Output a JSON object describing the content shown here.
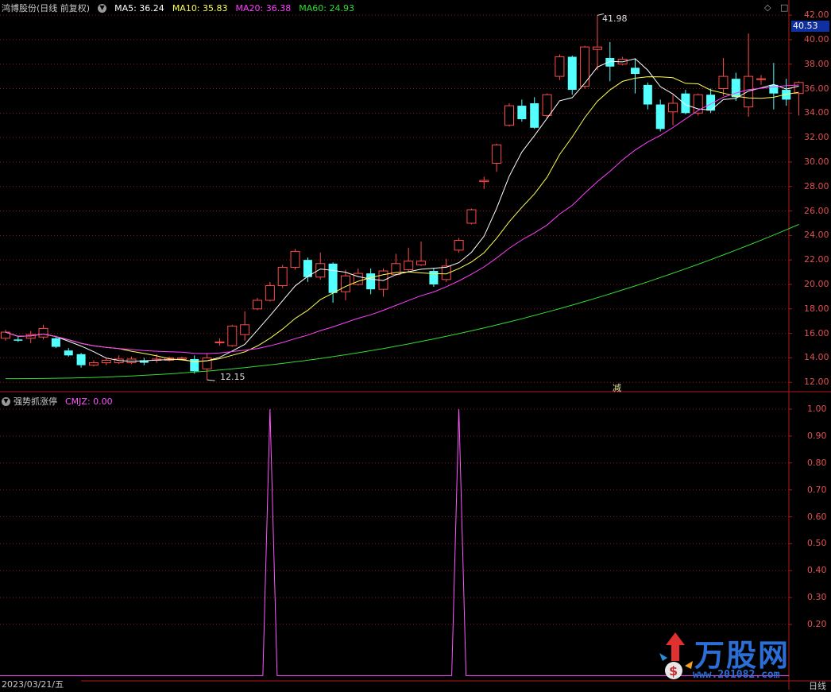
{
  "colors": {
    "background": "#000000",
    "up": "#ff4a4a",
    "down": "#54ffff",
    "grid": "#8b1a1a",
    "border": "#b01818",
    "ma5": "#ffffff",
    "ma10": "#ffff55",
    "ma20": "#ff40ff",
    "ma60": "#33dd33",
    "indicator": "#ff55ff",
    "axis_text": "#e05050",
    "price_tag_bg": "#1030a0"
  },
  "main_panel": {
    "title": "鸿博股份(日线 前复权)",
    "menu_icon": "chevron-down-icon",
    "ma": [
      {
        "label": "MA5: 36.24",
        "color": "#ffffff"
      },
      {
        "label": "MA10: 35.83",
        "color": "#ffff55"
      },
      {
        "label": "MA20: 36.38",
        "color": "#ff40ff"
      },
      {
        "label": "MA60: 24.93",
        "color": "#33dd33"
      }
    ],
    "y_ticks": [
      "42.00",
      "40.00",
      "38.00",
      "36.00",
      "34.00",
      "32.00",
      "30.00",
      "28.00",
      "26.00",
      "24.00",
      "22.00",
      "20.00",
      "18.00",
      "16.00",
      "14.00",
      "12.00"
    ],
    "current_price": "40.53",
    "high_label": "41.98",
    "low_label": "12.15",
    "marker_label": "减",
    "icons": [
      "diamond-icon",
      "square-icon"
    ]
  },
  "sub_panel": {
    "title": "强势抓涨停",
    "indicator_label": "CMJZ: 0.00",
    "menu_icon": "chevron-down-icon",
    "y_ticks": [
      "1.00",
      "0.90",
      "0.80",
      "0.70",
      "0.60",
      "0.50",
      "0.40",
      "0.30",
      "0.20"
    ]
  },
  "footer": {
    "date": "2023/03/21/五",
    "period": "日线"
  },
  "watermark": {
    "logo_text": "万股网",
    "url": "www.201082.com"
  },
  "candles": [
    [
      15.6,
      16.1,
      15.4,
      16.3
    ],
    [
      15.5,
      15.4,
      15.3,
      15.8
    ],
    [
      15.6,
      15.9,
      15.2,
      16.2
    ],
    [
      15.7,
      16.4,
      15.5,
      16.7
    ],
    [
      15.6,
      14.9,
      14.8,
      15.8
    ],
    [
      14.6,
      14.2,
      14.1,
      14.8
    ],
    [
      14.3,
      13.4,
      13.2,
      14.4
    ],
    [
      13.4,
      13.6,
      13.3,
      13.8
    ],
    [
      13.6,
      13.8,
      13.4,
      14.0
    ],
    [
      13.6,
      13.9,
      13.5,
      14.2
    ],
    [
      13.6,
      13.9,
      13.5,
      14.1
    ],
    [
      13.8,
      13.6,
      13.4,
      14.0
    ],
    [
      13.8,
      13.9,
      13.6,
      14.3
    ],
    [
      13.8,
      14.0,
      13.7,
      14.1
    ],
    [
      13.9,
      14.0,
      13.8,
      14.1
    ],
    [
      13.9,
      12.9,
      12.7,
      14.2
    ],
    [
      13.1,
      14.0,
      12.2,
      14.4
    ],
    [
      15.3,
      15.3,
      15.0,
      15.6
    ],
    [
      15.0,
      16.6,
      14.9,
      16.7
    ],
    [
      15.9,
      16.7,
      15.4,
      17.8
    ],
    [
      18.0,
      18.7,
      17.9,
      18.9
    ],
    [
      18.7,
      19.9,
      18.6,
      20.2
    ],
    [
      19.9,
      21.4,
      19.7,
      21.6
    ],
    [
      21.4,
      22.7,
      21.2,
      22.9
    ],
    [
      22.0,
      20.6,
      20.2,
      22.2
    ],
    [
      20.6,
      21.7,
      20.4,
      22.6
    ],
    [
      21.7,
      19.3,
      18.5,
      21.8
    ],
    [
      19.4,
      20.7,
      18.7,
      21.2
    ],
    [
      20.0,
      20.9,
      19.9,
      21.3
    ],
    [
      20.9,
      19.6,
      19.2,
      21.3
    ],
    [
      19.6,
      21.1,
      19.0,
      21.3
    ],
    [
      20.8,
      21.7,
      20.7,
      22.5
    ],
    [
      21.2,
      21.9,
      21.0,
      23.0
    ],
    [
      21.6,
      21.9,
      21.5,
      23.5
    ],
    [
      21.1,
      20.0,
      19.8,
      21.3
    ],
    [
      20.4,
      21.5,
      20.2,
      22.1
    ],
    [
      22.8,
      23.6,
      22.6,
      23.8
    ],
    [
      25.0,
      26.1,
      24.9,
      26.2
    ],
    [
      28.4,
      28.5,
      27.8,
      28.8
    ],
    [
      29.9,
      31.4,
      29.2,
      31.5
    ],
    [
      33.0,
      34.6,
      32.9,
      34.8
    ],
    [
      34.6,
      33.5,
      33.3,
      35.1
    ],
    [
      34.8,
      32.8,
      32.7,
      35.3
    ],
    [
      33.8,
      35.5,
      33.6,
      35.6
    ],
    [
      37.0,
      38.6,
      36.7,
      38.8
    ],
    [
      38.6,
      35.9,
      35.5,
      38.7
    ],
    [
      36.2,
      39.4,
      36.0,
      39.5
    ],
    [
      39.2,
      39.4,
      37.5,
      41.98
    ],
    [
      38.5,
      37.8,
      36.6,
      39.8
    ],
    [
      38.0,
      38.4,
      37.9,
      38.6
    ],
    [
      37.7,
      37.2,
      35.6,
      38.4
    ],
    [
      36.3,
      34.7,
      34.3,
      36.5
    ],
    [
      34.7,
      32.7,
      32.5,
      35.1
    ],
    [
      34.1,
      34.8,
      33.0,
      35.5
    ],
    [
      35.6,
      34.0,
      33.9,
      35.9
    ],
    [
      34.0,
      35.5,
      33.8,
      35.6
    ],
    [
      35.5,
      34.2,
      34.0,
      36.0
    ],
    [
      36.0,
      37.0,
      35.4,
      38.5
    ],
    [
      36.8,
      35.3,
      35.0,
      37.3
    ],
    [
      34.5,
      37.0,
      33.7,
      40.5
    ],
    [
      36.8,
      36.8,
      36.3,
      37.1
    ],
    [
      36.3,
      35.6,
      34.3,
      38.1
    ],
    [
      35.9,
      35.1,
      34.6,
      36.8
    ],
    [
      35.6,
      36.5,
      33.8,
      36.6
    ]
  ]
}
